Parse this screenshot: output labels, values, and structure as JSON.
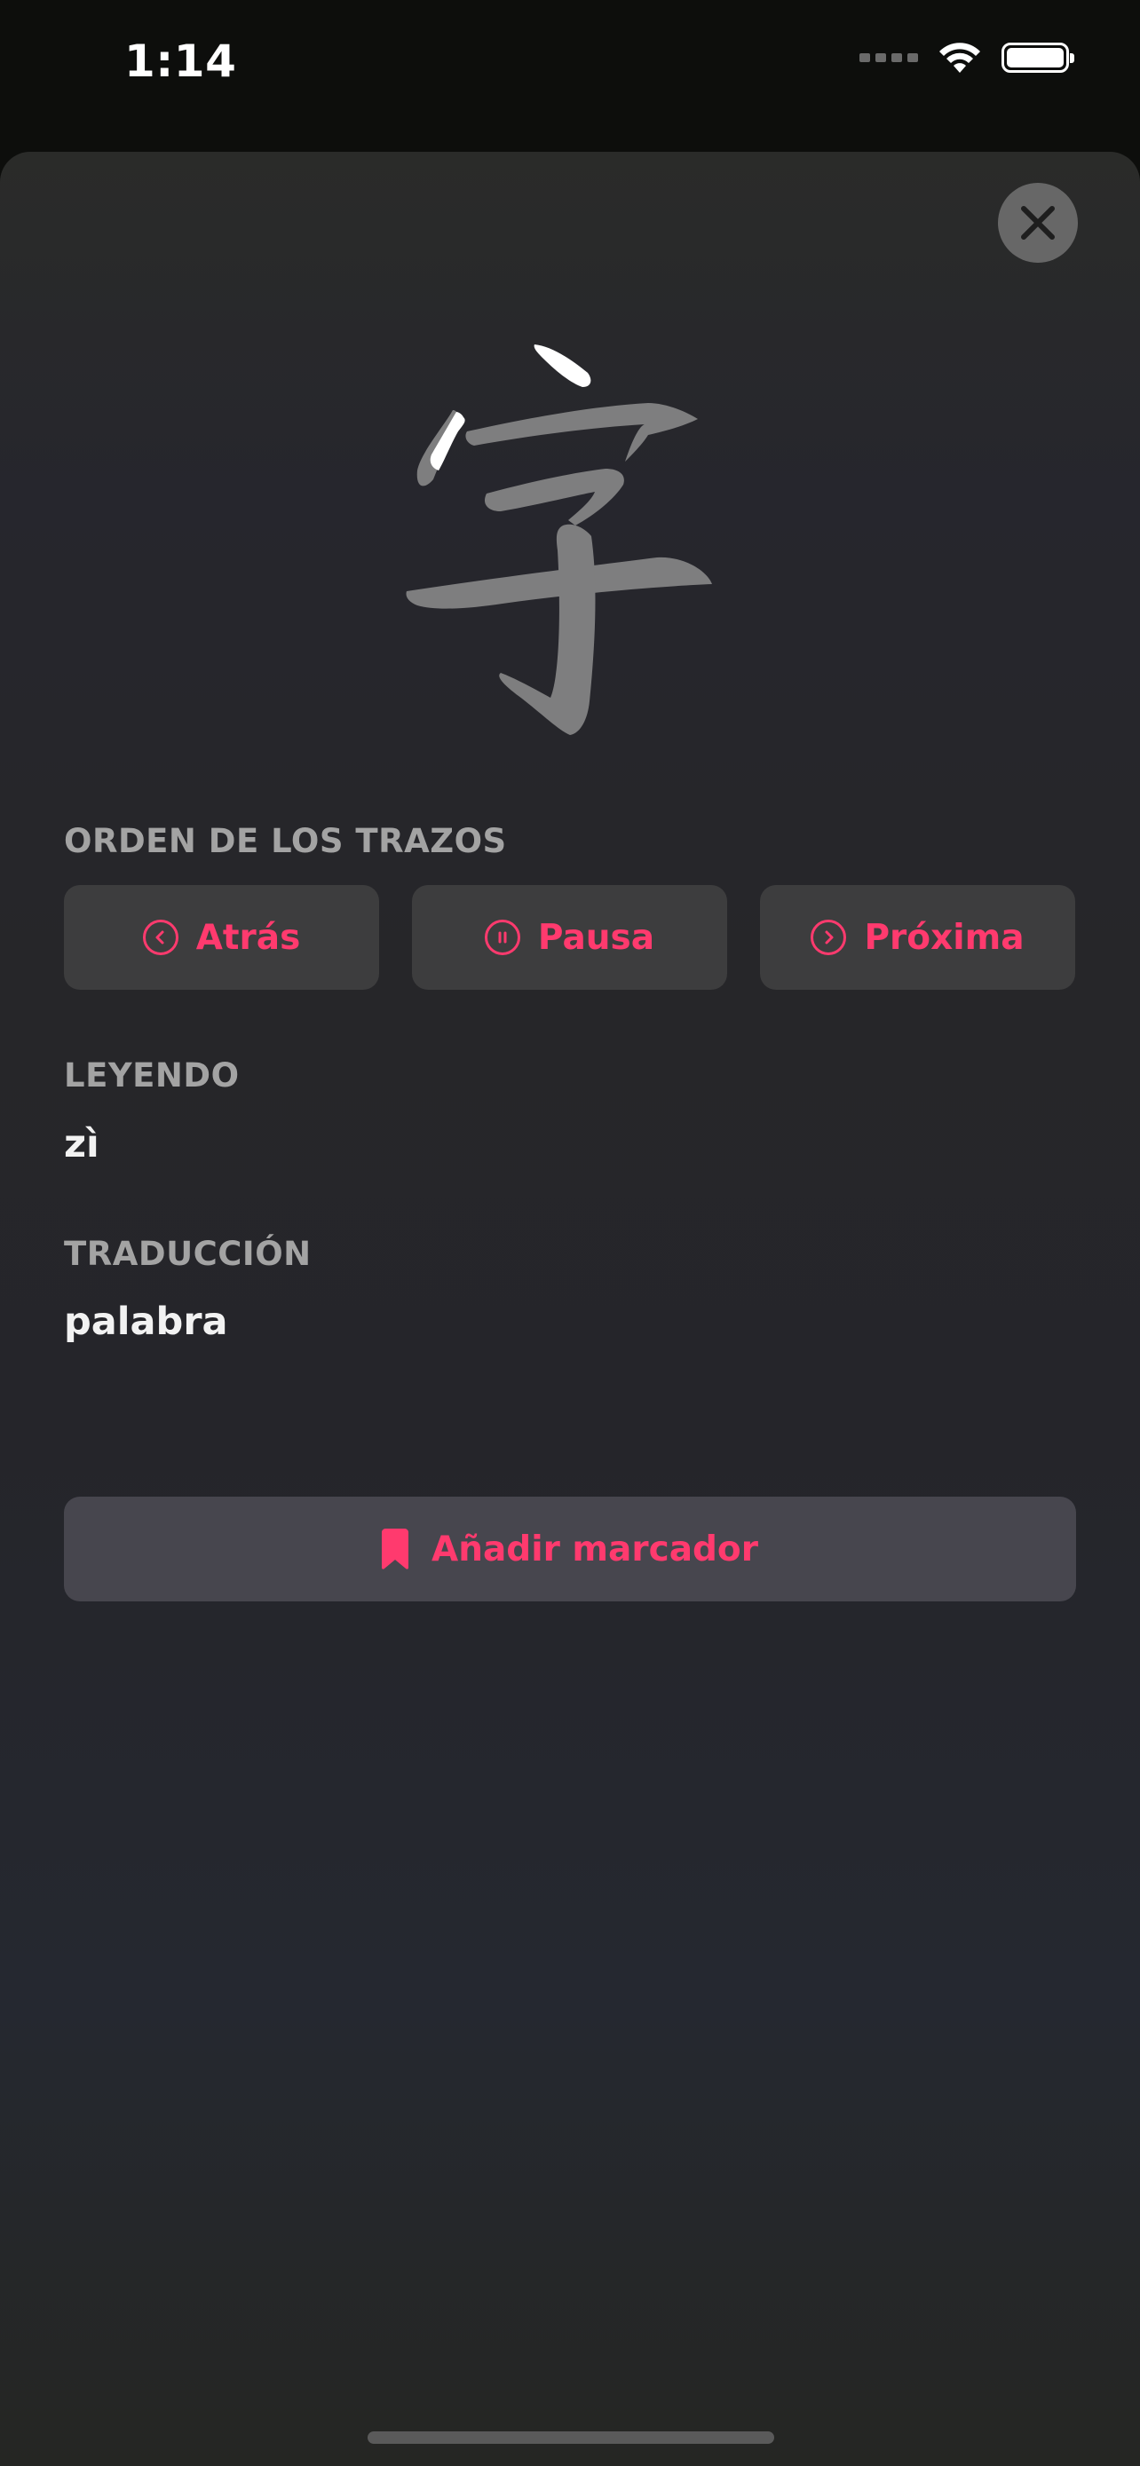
{
  "status_bar": {
    "time": "1:14"
  },
  "character": {
    "hanzi": "字"
  },
  "stroke_order": {
    "label": "ORDEN DE LOS TRAZOS",
    "back_label": "Atrás",
    "pause_label": "Pausa",
    "next_label": "Próxima"
  },
  "reading": {
    "label": "LEYENDO",
    "value": "zì"
  },
  "translation": {
    "label": "TRADUCCIÓN",
    "value": "palabra"
  },
  "bookmark": {
    "label": "Añadir marcador"
  },
  "colors": {
    "accent": "#ff3a6e",
    "stroke_done": "#ffffff",
    "stroke_pending": "#7e7e7f"
  },
  "icons": {
    "close": "close-icon",
    "back": "chevron-left-circle-icon",
    "pause": "pause-circle-icon",
    "next": "chevron-right-circle-icon",
    "bookmark": "bookmark-icon"
  }
}
